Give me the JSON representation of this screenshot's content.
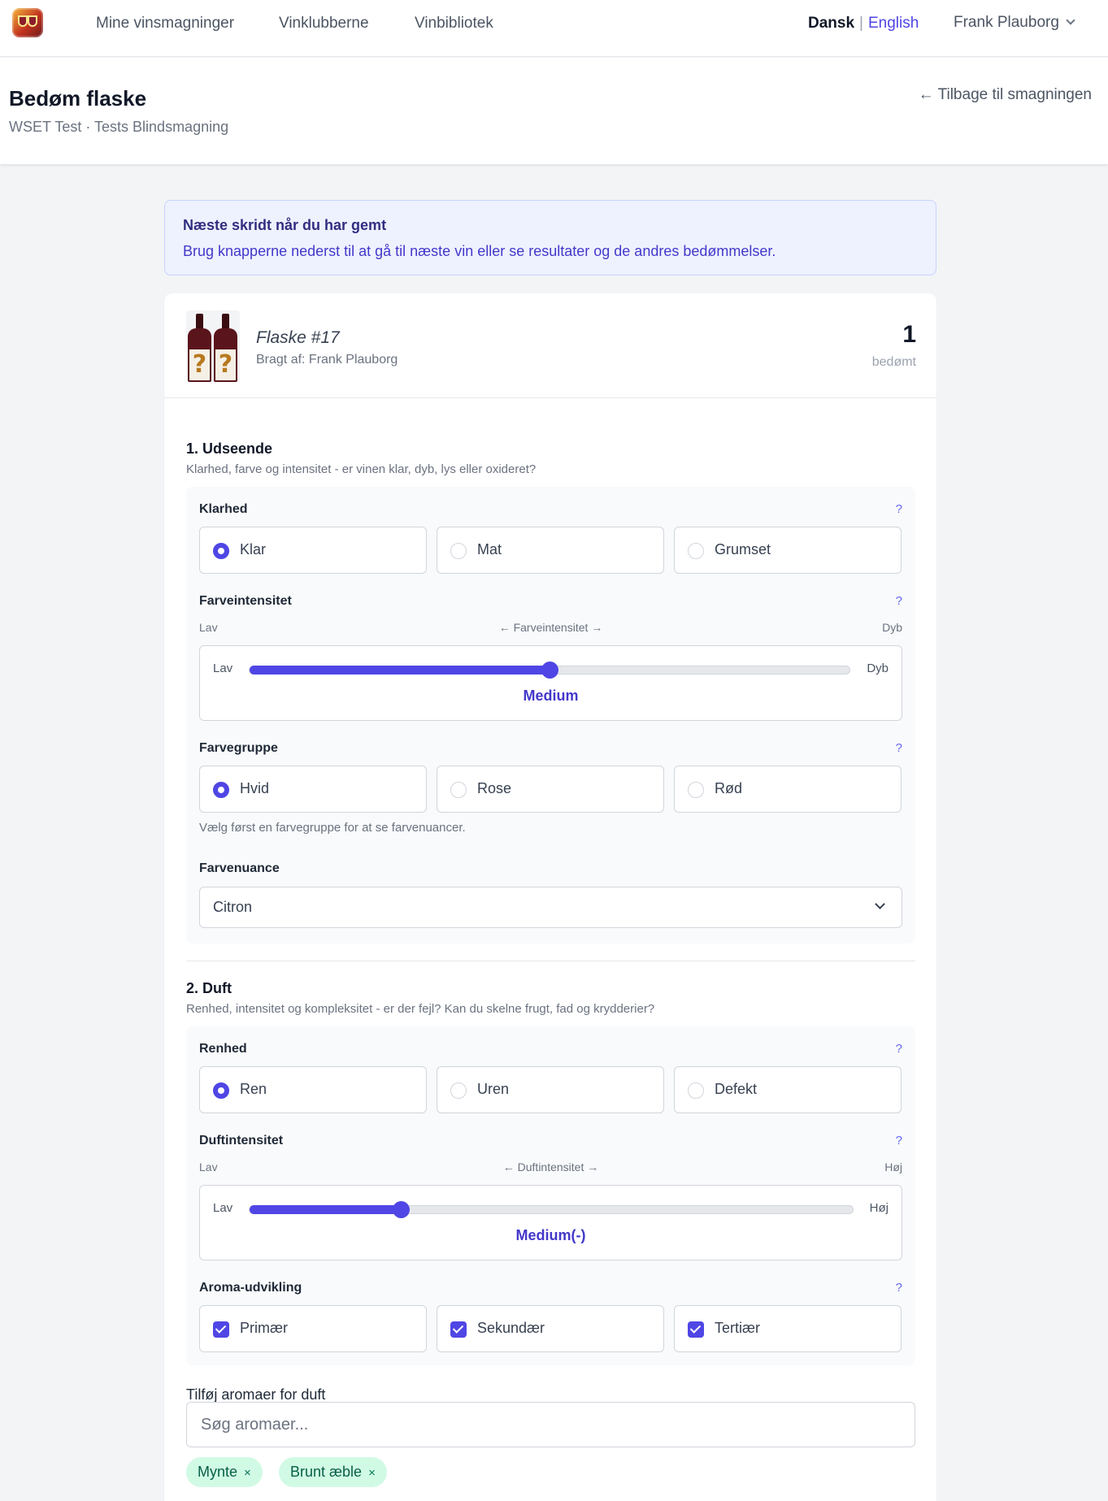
{
  "nav": {
    "links": [
      "Mine vinsmagninger",
      "Vinklubberne",
      "Vinbibliotek"
    ],
    "lang_active": "Dansk",
    "lang_sep": "|",
    "lang_other": "English",
    "user": "Frank Plauborg"
  },
  "header": {
    "title": "Bedøm flaske",
    "subtitle": "WSET Test · Tests Blindsmagning",
    "back": "← Tilbage til smagningen"
  },
  "banner": {
    "title": "Næste skridt når du har gemt",
    "text": "Brug knapperne nederst til at gå til næste vin eller se resultater og de andres bedømmelser."
  },
  "bottle": {
    "label_glyph": "?",
    "name": "Flaske #17",
    "brought_by": "Bragt af: Frank Plauborg",
    "rated_count": "1",
    "rated_label": "bedømt"
  },
  "appearance": {
    "title": "1. Udseende",
    "desc": "Klarhed, farve og intensitet - er vinen klar, dyb, lys eller oxideret?",
    "help": "?",
    "clarity": {
      "label": "Klarhed",
      "options": [
        "Klar",
        "Mat",
        "Grumset"
      ],
      "selected": 0
    },
    "intensity": {
      "label": "Farveintensitet",
      "hint_left": "Lav",
      "hint_center": "← Farveintensitet →",
      "hint_right": "Dyb",
      "min": "Lav",
      "max": "Dyb",
      "value": "Medium",
      "level": 0.5
    },
    "color_group": {
      "label": "Farvegruppe",
      "options": [
        "Hvid",
        "Rose",
        "Rød"
      ],
      "selected": 0,
      "note": "Vælg først en farvegruppe for at se farvenuancer."
    },
    "hue": {
      "label": "Farvenuance",
      "value": "Citron"
    }
  },
  "nose": {
    "title": "2. Duft",
    "desc": "Renhed, intensitet og kompleksitet - er der fejl? Kan du skelne frugt, fad og krydderier?",
    "condition": {
      "label": "Renhed",
      "options": [
        "Ren",
        "Uren",
        "Defekt"
      ],
      "selected": 0
    },
    "intensity": {
      "label": "Duftintensitet",
      "hint_left": "Lav",
      "hint_center": "← Duftintensitet →",
      "hint_right": "Høj",
      "min": "Lav",
      "max": "Høj",
      "value": "Medium(-)",
      "level": 0.25
    },
    "development": {
      "label": "Aroma-udvikling",
      "options": [
        "Primær",
        "Sekundær",
        "Tertiær"
      ],
      "checked": [
        true,
        true,
        true
      ]
    },
    "aromas": {
      "label": "Tilføj aromaer for duft",
      "placeholder": "Søg aromaer...",
      "chips": [
        "Mynte",
        "Brunt æble"
      ],
      "remove_glyph": "×"
    }
  },
  "colors": {
    "accent": "#4f46e5",
    "chip_bg": "#d1fae5"
  }
}
